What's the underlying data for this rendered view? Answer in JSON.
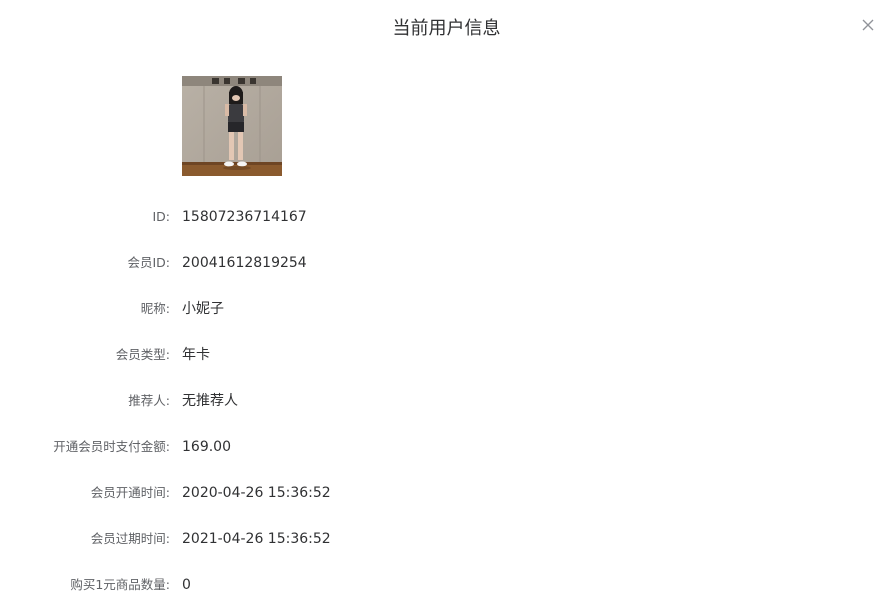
{
  "dialog": {
    "title": "当前用户信息",
    "close_icon": "close-icon"
  },
  "fields": [
    {
      "label": "ID:",
      "value": "15807236714167"
    },
    {
      "label": "会员ID:",
      "value": "20041612819254"
    },
    {
      "label": "昵称:",
      "value": "小妮子"
    },
    {
      "label": "会员类型:",
      "value": "年卡"
    },
    {
      "label": "推荐人:",
      "value": "无推荐人"
    },
    {
      "label": "开通会员时支付金额:",
      "value": "169.00"
    },
    {
      "label": "会员开通时间:",
      "value": "2020-04-26 15:36:52"
    },
    {
      "label": "会员过期时间:",
      "value": "2021-04-26 15:36:52"
    },
    {
      "label": "购买1元商品数量:",
      "value": "0"
    }
  ]
}
